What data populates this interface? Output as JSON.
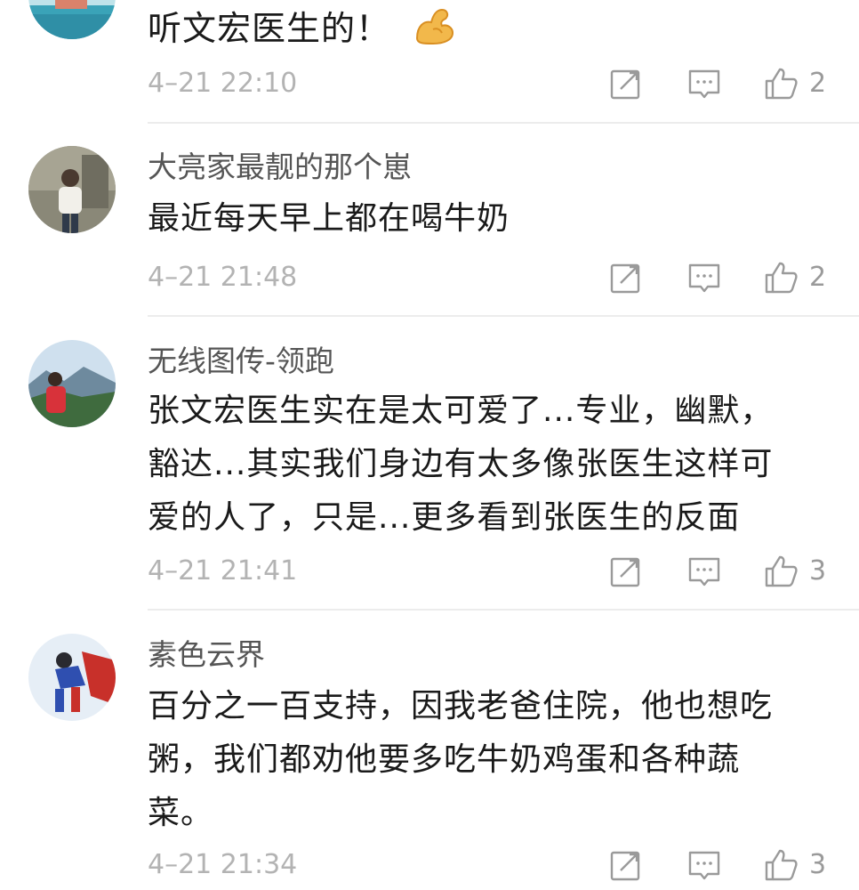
{
  "comments": [
    {
      "username": "",
      "content": "听文宏医生的！",
      "emoji": "flexed-biceps",
      "time": "4–21 22:10",
      "likes": "2"
    },
    {
      "username": "大亮家最靓的那个崽",
      "content": "最近每天早上都在喝牛奶",
      "time": "4–21 21:48",
      "likes": "2"
    },
    {
      "username": "无线图传-领跑",
      "content": "张文宏医生实在是太可爱了...专业，幽默，\n豁达...其实我们身边有太多像张医生这样可\n爱的人了，只是...更多看到张医生的反面",
      "time": "4–21 21:41",
      "likes": "3"
    },
    {
      "username": "素色云界",
      "content": "百分之一百支持，因我老爸住院，他也想吃\n粥，我们都劝他要多吃牛奶鸡蛋和各种蔬\n菜。",
      "time": "4–21 21:34",
      "likes": "3"
    }
  ],
  "icons": {
    "repost": "repost-icon",
    "comment": "comment-icon",
    "like": "thumbs-up-icon"
  },
  "colors": {
    "text": "#1a1a1a",
    "username": "#555555",
    "meta": "#b3b3b3",
    "icon": "#9a9a9a",
    "divider": "#ececec"
  }
}
